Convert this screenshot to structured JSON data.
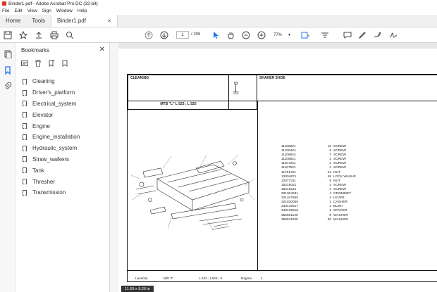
{
  "window": {
    "title": "Binder1.pdf - Adobe Acrobat Pro DC (32-bit)"
  },
  "menu": [
    "File",
    "Edit",
    "View",
    "Sign",
    "Window",
    "Help"
  ],
  "tabs": {
    "home": "Home",
    "tools": "Tools",
    "document": "Binder1.pdf"
  },
  "toolbar": {
    "current_page": "1",
    "page_count": "/ 398",
    "zoom": "77%"
  },
  "bookmarks": {
    "title": "Bookmarks",
    "items": [
      "Cleaning",
      "Driver's_platform",
      "Electrical_system",
      "Elevator",
      "Engine",
      "Engine_installation",
      "Hydraulic_system",
      "Straw_walkers",
      "Tank",
      "Thresher",
      "Transmission"
    ]
  },
  "document": {
    "section": "CLEANING",
    "model": "MTB \"L\" L 523 ; L 525",
    "assembly": "SHAKER SHOE",
    "parts": [
      {
        "code": "11106221",
        "qty": "16",
        "desc": "SCREW"
      },
      {
        "code": "11106424",
        "qty": "6",
        "desc": "SCREW"
      },
      {
        "code": "11106624",
        "qty": "7",
        "desc": "SCREW"
      },
      {
        "code": "11106821",
        "qty": "2",
        "desc": "SCREW"
      },
      {
        "code": "11107221",
        "qty": "2",
        "desc": "SCREW"
      },
      {
        "code": "11107521",
        "qty": "4",
        "desc": "SCREW"
      },
      {
        "code": "11701721",
        "qty": "42",
        "desc": "NUT"
      },
      {
        "code": "12034671",
        "qty": "48",
        "desc": "LOCK WASHE"
      },
      {
        "code": "12577211",
        "qty": "8",
        "desc": "NUT"
      },
      {
        "code": "15215021",
        "qty": "4",
        "desc": "SCREW"
      },
      {
        "code": "15215221",
        "qty": "4",
        "desc": "SCREW"
      },
      {
        "code": "301004631",
        "qty": "4",
        "desc": "GROMMET"
      },
      {
        "code": "321347650",
        "qty": "4",
        "desc": "LEVER"
      },
      {
        "code": "321830050",
        "qty": "1",
        "desc": "CASHER"
      },
      {
        "code": "340415617",
        "qty": "2",
        "desc": "BUSH"
      },
      {
        "code": "340415618",
        "qty": "2",
        "desc": "SPACER"
      },
      {
        "code": "355501120",
        "qty": "8",
        "desc": "WASHER"
      },
      {
        "code": "355511030",
        "qty": "36",
        "desc": "WASHER"
      }
    ],
    "footer": {
      "brand": "Laverda",
      "model": "Mtb \"l\"",
      "ref": "L 523 ; L525 ; 0",
      "page_label": "Pagina",
      "page": "1"
    }
  },
  "status": {
    "page_size": "11.69 x 8.26 in"
  }
}
